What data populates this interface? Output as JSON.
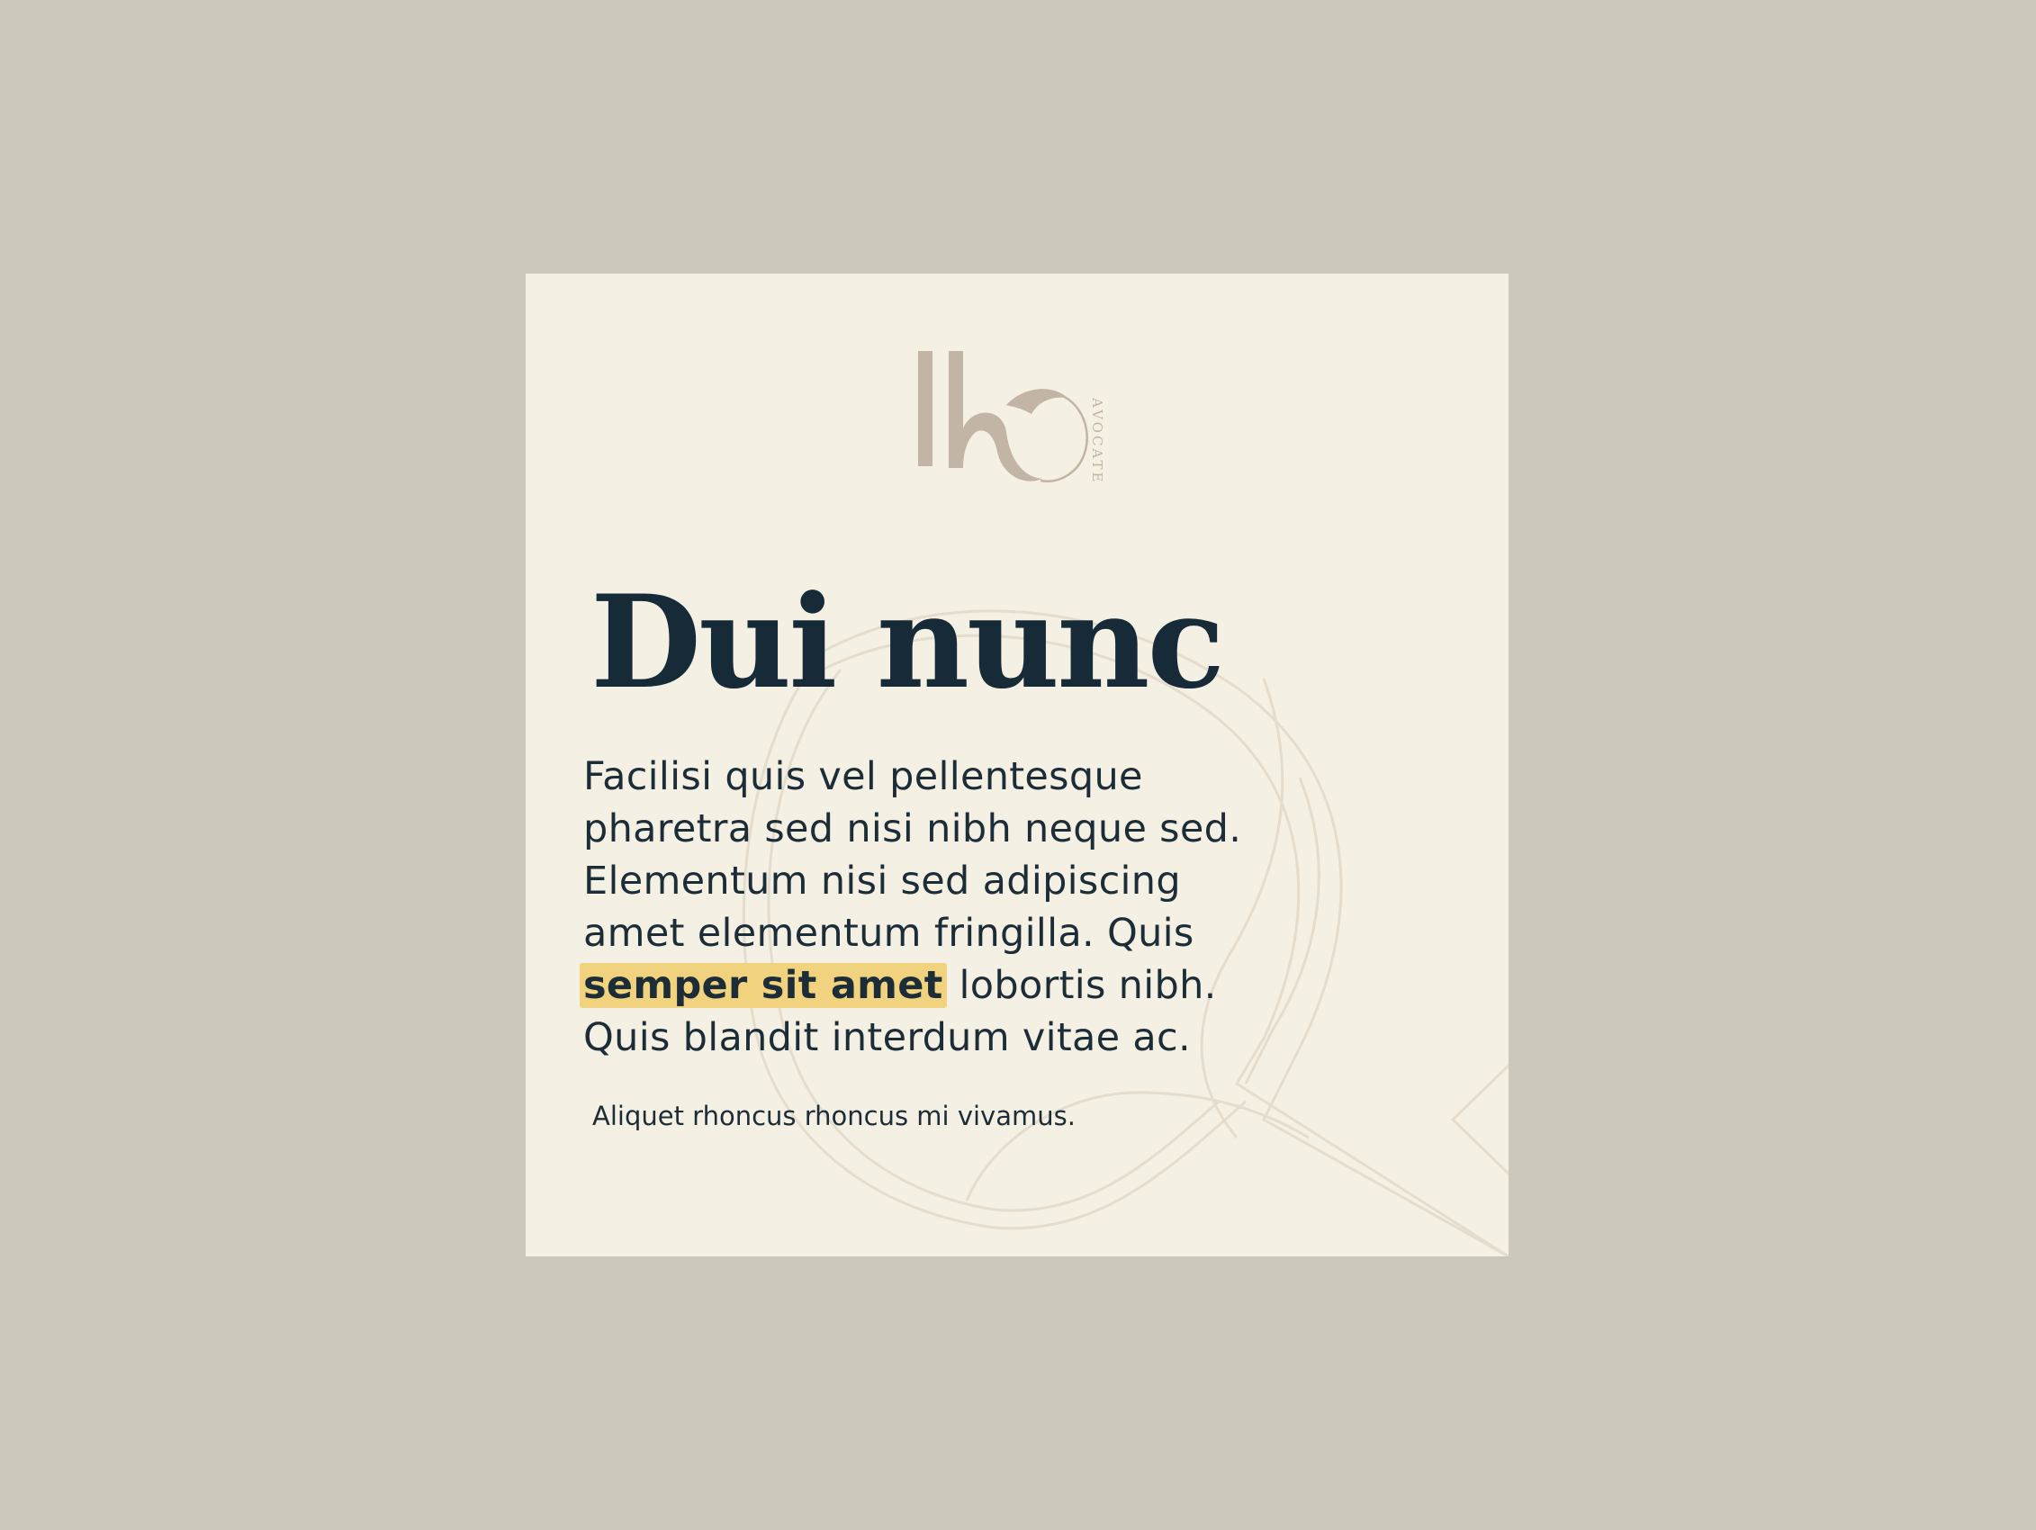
{
  "card": {
    "logo": {
      "monogram": "lk",
      "wordmark": "AVOCATE",
      "color": "#c2b5a6"
    },
    "headline": "Dui nunc",
    "paragraph": {
      "before_highlight": "Facilisi quis vel pellentesque pharetra sed nisi nibh neque sed. Elementum nisi sed adipiscing amet elementum fringilla. Quis ",
      "highlight": "semper sit amet",
      "after_highlight": " lobortis nibh. Quis blandit interdum vitae ac."
    },
    "caption": "Aliquet rhoncus rhoncus mi vivamus."
  },
  "colors": {
    "page_background": "#cbc8bb",
    "card_background": "#f5f0e4",
    "text": "#162a38",
    "highlight": "#f1d27f",
    "watermark_stroke": "#e4ddcd"
  }
}
